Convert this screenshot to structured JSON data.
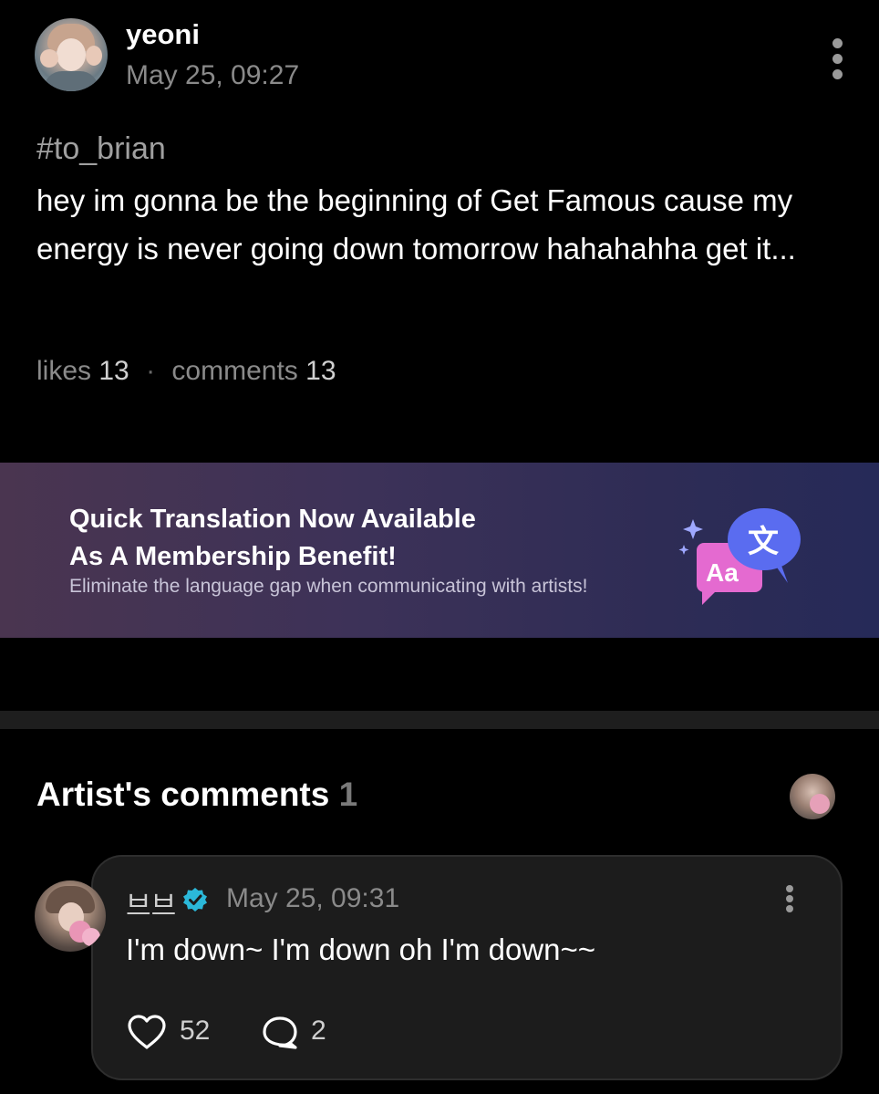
{
  "post": {
    "username": "yeoni",
    "time": "May 25, 09:27",
    "hashtag": "#to_brian",
    "body": "hey im gonna be the beginning of Get Famous cause my energy is never going down tomorrow hahahahha get it...",
    "likes_label": "likes",
    "likes": "13",
    "comments_label": "comments",
    "comments": "13",
    "separator": "·"
  },
  "banner": {
    "title_line1": "Quick Translation Now Available",
    "title_line2": "As A Membership Benefit!",
    "subtitle": "Eliminate the language gap when communicating with artists!",
    "icon_glyph_back": "Aa",
    "icon_glyph_front": "文"
  },
  "artist_comments": {
    "title": "Artist's comments",
    "count": "1",
    "comment": {
      "author": "브브",
      "time": "May 25, 09:31",
      "text": "I'm down~ I'm down oh I'm down~~",
      "likes": "52",
      "replies": "2"
    }
  },
  "colors": {
    "background": "#000000",
    "muted_text": "#8a8a8a",
    "verified": "#2bb8d9",
    "banner_start": "#4a3550",
    "banner_end": "#262a58",
    "translate_pink": "#e46ad0",
    "translate_blue": "#5a6cf0"
  },
  "icons": [
    "more-vertical-icon",
    "translate-icon",
    "sparkle-icon",
    "verified-badge-icon",
    "heart-icon",
    "comment-bubble-icon"
  ]
}
